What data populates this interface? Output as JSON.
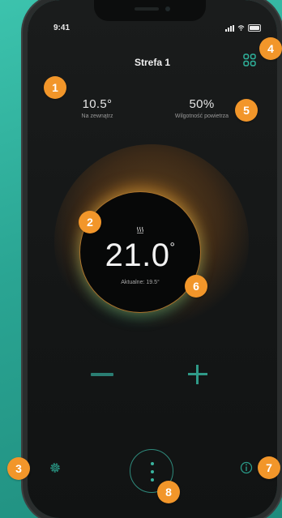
{
  "status_bar": {
    "time": "9:41"
  },
  "header": {
    "title": "Strefa 1"
  },
  "stats": {
    "outdoor": {
      "value": "10.5°",
      "label": "Na zewnątrz"
    },
    "humidity": {
      "value": "50%",
      "label": "Wilgotność powietrza"
    }
  },
  "thermostat": {
    "setpoint": "21.0",
    "degree": "°",
    "current": "Aktualne: 19.5°"
  },
  "annotations": [
    "1",
    "2",
    "3",
    "4",
    "5",
    "6",
    "7",
    "8"
  ],
  "colors": {
    "accent_green": "#39b49f",
    "glow_orange": "#f0962a",
    "badge": "#f2962a",
    "background_teal": "#2aa593"
  },
  "icons": {
    "settings": "gear-icon",
    "menu": "more-vertical-icon",
    "info": "info-icon",
    "zones": "grid-icon",
    "heating": "heating-icon"
  }
}
